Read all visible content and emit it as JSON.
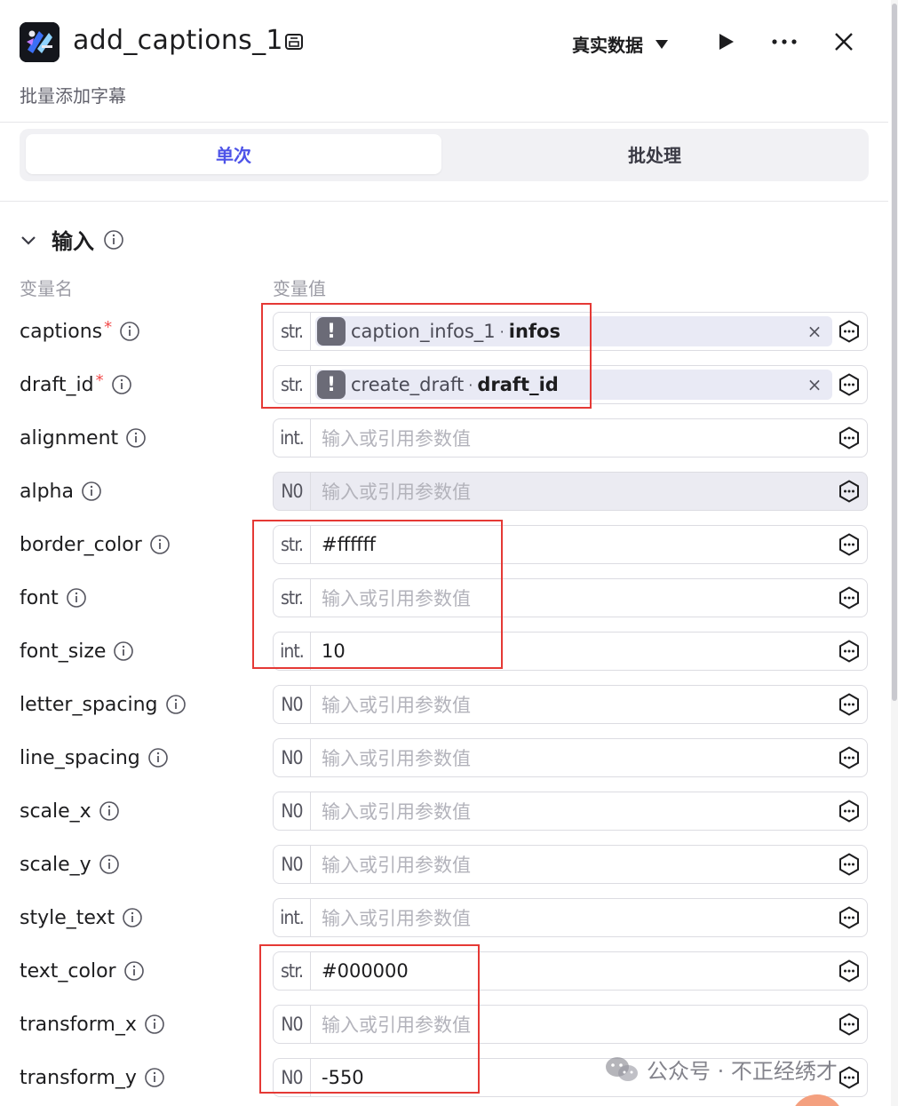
{
  "header": {
    "title": "add_captions_1",
    "subtitle": "批量添加字幕",
    "mode_label": "真实数据"
  },
  "tabs": [
    {
      "label": "单次",
      "active": true
    },
    {
      "label": "批处理",
      "active": false
    }
  ],
  "input_section": {
    "title": "输入",
    "col_name_label": "变量名",
    "col_value_label": "变量值",
    "placeholder": "输入或引用参数值",
    "rows": [
      {
        "name": "captions",
        "required": true,
        "type": "str.",
        "kind": "ref",
        "ref_node": "caption_infos_1",
        "ref_var": "infos"
      },
      {
        "name": "draft_id",
        "required": true,
        "type": "str.",
        "kind": "ref",
        "ref_node": "create_draft",
        "ref_var": "draft_id"
      },
      {
        "name": "alignment",
        "required": false,
        "type": "int.",
        "kind": "empty"
      },
      {
        "name": "alpha",
        "required": false,
        "type": "N0",
        "kind": "empty",
        "disabled": true
      },
      {
        "name": "border_color",
        "required": false,
        "type": "str.",
        "kind": "value",
        "value": "#ffffff"
      },
      {
        "name": "font",
        "required": false,
        "type": "str.",
        "kind": "empty"
      },
      {
        "name": "font_size",
        "required": false,
        "type": "int.",
        "kind": "value",
        "value": "10"
      },
      {
        "name": "letter_spacing",
        "required": false,
        "type": "N0",
        "kind": "empty"
      },
      {
        "name": "line_spacing",
        "required": false,
        "type": "N0",
        "kind": "empty"
      },
      {
        "name": "scale_x",
        "required": false,
        "type": "N0",
        "kind": "empty"
      },
      {
        "name": "scale_y",
        "required": false,
        "type": "N0",
        "kind": "empty"
      },
      {
        "name": "style_text",
        "required": false,
        "type": "int.",
        "kind": "empty"
      },
      {
        "name": "text_color",
        "required": false,
        "type": "str.",
        "kind": "value",
        "value": "#000000"
      },
      {
        "name": "transform_x",
        "required": false,
        "type": "N0",
        "kind": "empty"
      },
      {
        "name": "transform_y",
        "required": false,
        "type": "N0",
        "kind": "value",
        "value": "-550"
      }
    ]
  },
  "watermark": {
    "text": "公众号 · 不正经绣才"
  },
  "colors": {
    "accent": "#4d53e8",
    "required": "#f24b4b",
    "annotation": "#e53935"
  }
}
